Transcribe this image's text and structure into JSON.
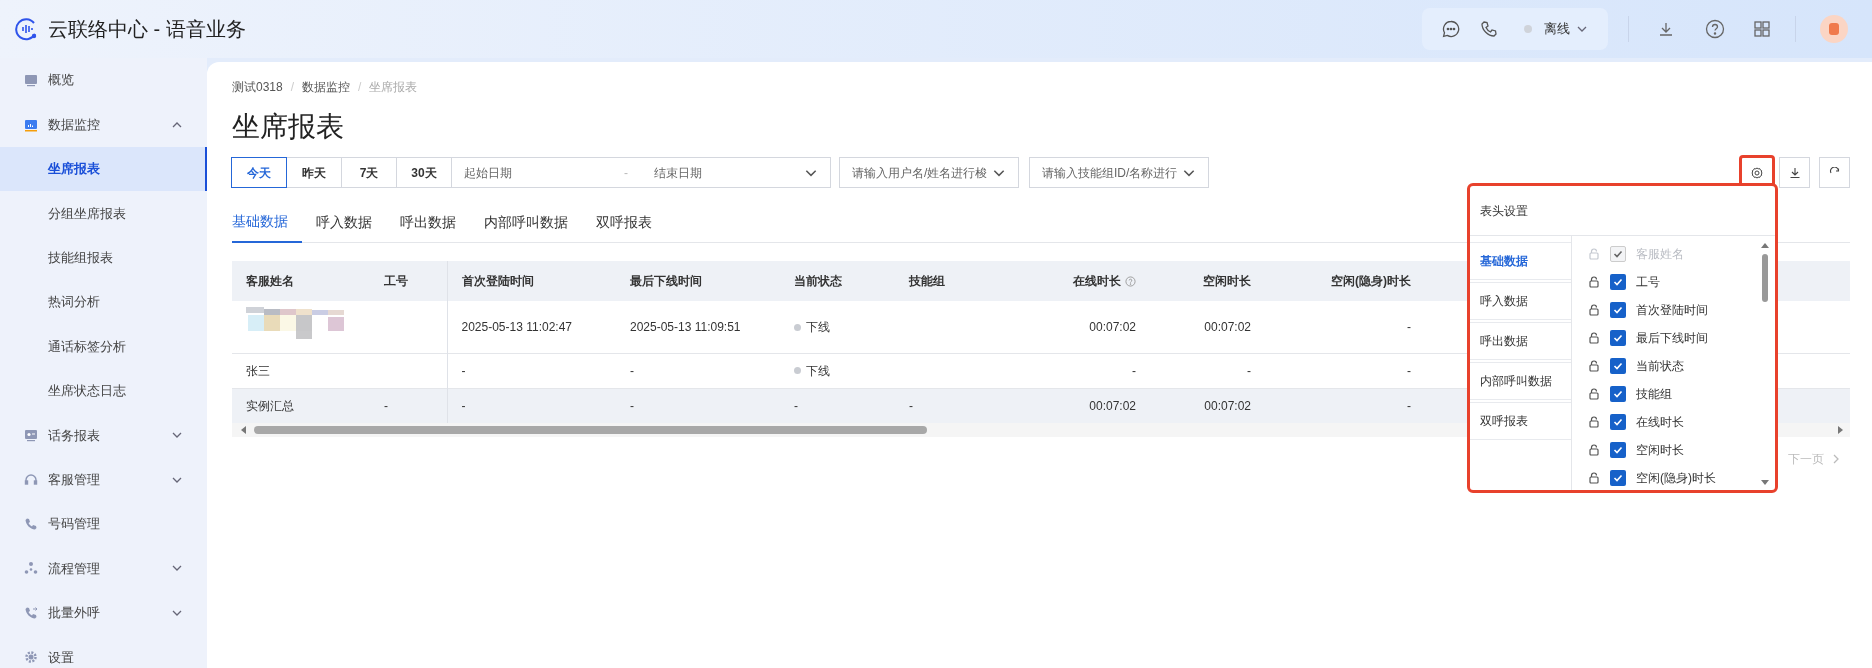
{
  "app": {
    "title": "云联络中心 - 语音业务",
    "status": {
      "label": "离线"
    }
  },
  "sidebar": {
    "items": [
      {
        "label": "概览"
      },
      {
        "label": "数据监控",
        "expanded": true,
        "children": [
          {
            "label": "坐席报表",
            "selected": true
          },
          {
            "label": "分组坐席报表",
            "selected": false
          },
          {
            "label": "技能组报表",
            "selected": false
          },
          {
            "label": "热词分析",
            "selected": false
          },
          {
            "label": "通话标签分析",
            "selected": false
          },
          {
            "label": "坐席状态日志",
            "selected": false
          }
        ]
      },
      {
        "label": "话务报表",
        "expanded": false
      },
      {
        "label": "客服管理",
        "expanded": false
      },
      {
        "label": "号码管理"
      },
      {
        "label": "流程管理",
        "expanded": false
      },
      {
        "label": "批量外呼",
        "expanded": false
      },
      {
        "label": "设置"
      }
    ]
  },
  "breadcrumb": [
    {
      "kind": "link",
      "text": "测试0318"
    },
    {
      "kind": "separator",
      "text": "/"
    },
    {
      "kind": "link",
      "text": "数据监控"
    },
    {
      "kind": "separator",
      "text": "/"
    },
    {
      "kind": "current",
      "text": "坐席报表"
    }
  ],
  "page_title": "坐席报表",
  "filters": {
    "ranges": [
      {
        "label": "今天",
        "selected": true
      },
      {
        "label": "昨天",
        "selected": false
      },
      {
        "label": "7天",
        "selected": false
      },
      {
        "label": "30天",
        "selected": false
      }
    ],
    "start_placeholder": "起始日期",
    "separator": "-",
    "end_placeholder": "结束日期",
    "user_placeholder": "请输入用户名/姓名进行梭",
    "skill_placeholder": "请输入技能组ID/名称进行"
  },
  "tabs": [
    {
      "label": "基础数据",
      "selected": true
    },
    {
      "label": "呼入数据",
      "selected": false
    },
    {
      "label": "呼出数据",
      "selected": false
    },
    {
      "label": "内部呼叫数据",
      "selected": false
    },
    {
      "label": "双呼报表",
      "selected": false
    }
  ],
  "table": {
    "columns": [
      {
        "label": "客服姓名",
        "kind": "text"
      },
      {
        "label": "工号",
        "kind": "text"
      },
      {
        "label": "首次登陆时间",
        "kind": "text"
      },
      {
        "label": "最后下线时间",
        "kind": "text"
      },
      {
        "label": "当前状态",
        "kind": "text"
      },
      {
        "label": "技能组",
        "kind": "text"
      },
      {
        "label": "在线时长",
        "kind": "duration",
        "help": true
      },
      {
        "label": "空闲时长",
        "kind": "duration",
        "help": false
      },
      {
        "label": "空闲(隐身)时长",
        "kind": "duration",
        "help": false
      }
    ],
    "rows": [
      {
        "summary": false,
        "cells": [
          {
            "kind": "picture"
          },
          null,
          "2025-05-13 11:02:47",
          "2025-05-13 11:09:51",
          {
            "status": "下线"
          },
          null,
          "00:07:02",
          "00:07:02",
          "-"
        ]
      },
      {
        "summary": false,
        "cells": [
          "张三",
          null,
          "-",
          "-",
          {
            "status": "下线"
          },
          null,
          "-",
          "-",
          "-"
        ]
      },
      {
        "summary": true,
        "cells": [
          "实例汇总",
          "-",
          "-",
          "-",
          "-",
          "-",
          "00:07:02",
          "00:07:02",
          "-"
        ]
      }
    ]
  },
  "pagination": {
    "next": "下一页"
  },
  "column_settings": {
    "title": "表头设置",
    "groups": [
      {
        "label": "基础数据",
        "selected": true
      },
      {
        "label": "呼入数据",
        "selected": false
      },
      {
        "label": "呼出数据",
        "selected": false
      },
      {
        "label": "内部呼叫数据",
        "selected": false
      },
      {
        "label": "双呼报表",
        "selected": false
      }
    ],
    "fields": [
      {
        "label": "客服姓名",
        "checked": true,
        "disabled": true
      },
      {
        "label": "工号",
        "checked": true,
        "disabled": false
      },
      {
        "label": "首次登陆时间",
        "checked": true,
        "disabled": false
      },
      {
        "label": "最后下线时间",
        "checked": true,
        "disabled": false
      },
      {
        "label": "当前状态",
        "checked": true,
        "disabled": false
      },
      {
        "label": "技能组",
        "checked": true,
        "disabled": false
      },
      {
        "label": "在线时长",
        "checked": true,
        "disabled": false
      },
      {
        "label": "空闲时长",
        "checked": true,
        "disabled": false
      },
      {
        "label": "空闲(隐身)时长",
        "checked": true,
        "disabled": false
      }
    ]
  }
}
